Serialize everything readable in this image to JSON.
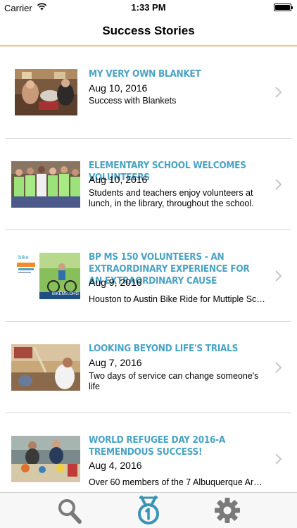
{
  "status_bar": {
    "carrier": "Carrier",
    "time": "1:33 PM",
    "icons": [
      "wifi-icon",
      "battery-icon"
    ]
  },
  "nav": {
    "title": "Success Stories"
  },
  "stories": [
    {
      "title": "MY VERY OWN BLANKET",
      "date": "Aug 10, 2016",
      "description": "Success with Blankets"
    },
    {
      "title": "ELEMENTARY SCHOOL WELCOMES VOLUNTEERS",
      "date": "Aug 10, 2016",
      "description": "Students and teachers enjoy volunteers at lunch, in the library, throughout the school."
    },
    {
      "title": "BP MS 150 VOLUNTEERS - AN EXTRAORDINARY EXPERIENCE FOR AN EXTRAORDINARY CAUSE",
      "date": "Aug 9, 2016",
      "description": "Houston to Austin Bike Ride for Muttiple Scl…",
      "thumb_text_top": "bike",
      "thumb_text_bottom": "BIKEMS.ORG"
    },
    {
      "title": "LOOKING BEYOND LIFE'S TRIALS",
      "date": "Aug 7, 2016",
      "description": "Two days of service can change someone's life"
    },
    {
      "title": "WORLD REFUGEE DAY 2016-A TREMENDOUS SUCCESS!",
      "date": "Aug 4, 2016",
      "description": "Over 60 members of the 7 Albuquerque Are…"
    }
  ],
  "tabs": [
    {
      "icon": "search-icon",
      "active": false
    },
    {
      "icon": "medal-icon",
      "active": true
    },
    {
      "icon": "gear-icon",
      "active": false
    }
  ],
  "colors": {
    "accent": "#4aa3c5",
    "nav_border": "#e9c48a",
    "tab_active": "#3a93b5",
    "tab_inactive": "#7a7a7a",
    "chevron": "#c7c7cc"
  }
}
